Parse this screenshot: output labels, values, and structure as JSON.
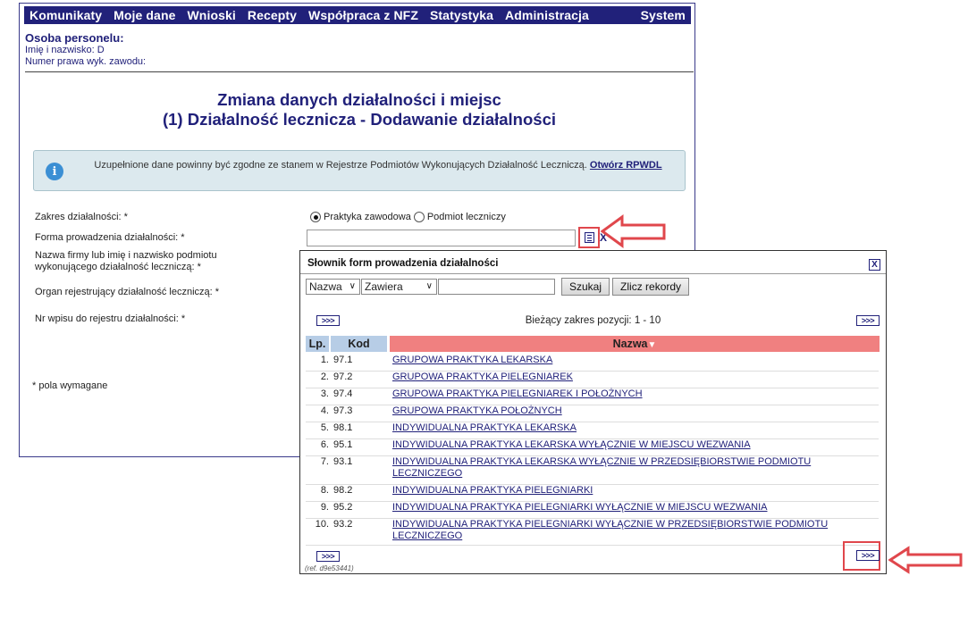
{
  "menu": [
    "Komunikaty",
    "Moje dane",
    "Wnioski",
    "Recepty",
    "Współpraca z NFZ",
    "Statystyka",
    "Administracja",
    "System"
  ],
  "person": {
    "heading": "Osoba personelu:",
    "name_label": "Imię i nazwisko: D",
    "license_label": "Numer prawa wyk. zawodu:"
  },
  "title": {
    "line1": "Zmiana danych działalności i miejsc",
    "line2": "(1) Działalność lecznicza - Dodawanie działalności"
  },
  "info": {
    "text": "Uzupełnione dane powinny być zgodne ze stanem w Rejestrze Podmiotów Wykonujących Działalność Leczniczą.",
    "link": "Otwórz RPWDL"
  },
  "form": {
    "zakres_label": "Zakres działalności: *",
    "radio1": "Praktyka zawodowa",
    "radio2": "Podmiot leczniczy",
    "forma_label": "Forma prowadzenia działalności: *",
    "clear": "X",
    "nazwa_label_1": "Nazwa firmy lub imię i nazwisko podmiotu",
    "nazwa_label_2": "wykonującego działalność leczniczą: *",
    "organ_label": "Organ rejestrujący działalność leczniczą: *",
    "nr_label": "Nr wpisu do rejestru działalności: *",
    "required_note": "* pola wymagane"
  },
  "popup": {
    "title": "Słownik form prowadzenia działalności",
    "close": "X",
    "field_select": "Nazwa",
    "op_select": "Zawiera",
    "search_value": "",
    "search_btn": "Szukaj",
    "count_btn": "Zlicz rekordy",
    "next": ">>>",
    "range": "Bieżący zakres pozycji: 1 - 10",
    "col_lp": "Lp.",
    "col_kod": "Kod",
    "col_nazwa": "Nazwa",
    "sort_marker": "▼",
    "ref": "(ref. d9e53441)",
    "rows": [
      {
        "lp": "1.",
        "kod": "97.1",
        "name": "GRUPOWA PRAKTYKA LEKARSKA"
      },
      {
        "lp": "2.",
        "kod": "97.2",
        "name": "GRUPOWA PRAKTYKA PIELEGNIAREK"
      },
      {
        "lp": "3.",
        "kod": "97.4",
        "name": "GRUPOWA PRAKTYKA PIELEGNIAREK I POŁOŻNYCH"
      },
      {
        "lp": "4.",
        "kod": "97.3",
        "name": "GRUPOWA PRAKTYKA POŁOŻNYCH"
      },
      {
        "lp": "5.",
        "kod": "98.1",
        "name": "INDYWIDUALNA PRAKTYKA LEKARSKA"
      },
      {
        "lp": "6.",
        "kod": "95.1",
        "name": "INDYWIDUALNA PRAKTYKA LEKARSKA WYŁĄCZNIE W MIEJSCU WEZWANIA"
      },
      {
        "lp": "7.",
        "kod": "93.1",
        "name": "INDYWIDUALNA PRAKTYKA LEKARSKA WYŁĄCZNIE W PRZEDSIĘBIORSTWIE PODMIOTU LECZNICZEGO"
      },
      {
        "lp": "8.",
        "kod": "98.2",
        "name": "INDYWIDUALNA PRAKTYKA PIELEGNIARKI"
      },
      {
        "lp": "9.",
        "kod": "95.2",
        "name": "INDYWIDUALNA PRAKTYKA PIELEGNIARKI WYŁĄCZNIE W MIEJSCU WEZWANIA"
      },
      {
        "lp": "10.",
        "kod": "93.2",
        "name": "INDYWIDUALNA PRAKTYKA PIELEGNIARKI WYŁĄCZNIE W PRZEDSIĘBIORSTWIE PODMIOTU LECZNICZEGO"
      }
    ]
  },
  "colors": {
    "menu_bg": "#21217a",
    "header_nazwa": "#f08080",
    "header_lp_kod": "#b7cde6",
    "highlight": "#e0474c"
  }
}
